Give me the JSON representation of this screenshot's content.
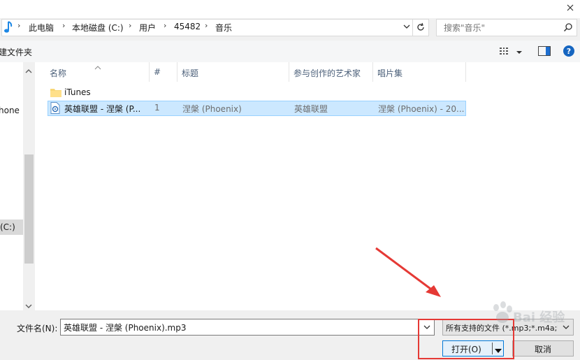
{
  "breadcrumb": [
    "此电脑",
    "本地磁盘 (C:)",
    "用户",
    "45482",
    "音乐"
  ],
  "search": {
    "placeholder": "搜索\"音乐\""
  },
  "toolbar": {
    "new_folder": "建文件夹"
  },
  "nav": {
    "item_phone": "hone",
    "item_drive": "(C:)"
  },
  "columns": [
    "名称",
    "#",
    "标题",
    "参与创作的艺术家",
    "唱片集"
  ],
  "files": [
    {
      "name": "iTunes",
      "num": "",
      "title": "",
      "artist": "",
      "album": ""
    },
    {
      "name": "英雄联盟 - 涅槃 (P...",
      "num": "1",
      "title": "涅槃 (Phoenix)",
      "artist": "英雄联盟",
      "album": "涅槃 (Phoenix) - 20..."
    }
  ],
  "bottom": {
    "filename_label": "文件名(N):",
    "filename_value": "英雄联盟 - 涅槃 (Phoenix).mp3",
    "filetype_value": "所有支持的文件 (*.mp3;*.m4a;*",
    "open_label": "打开(O)",
    "cancel_label": "取消"
  },
  "watermark": "Bai 经验",
  "colors": {
    "accent": "#0078d7",
    "selection": "#cce8ff",
    "annotation": "#e53935"
  }
}
